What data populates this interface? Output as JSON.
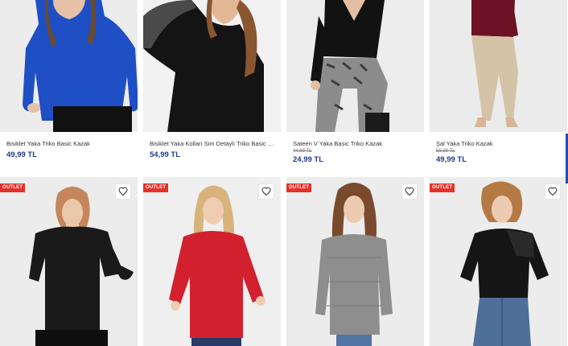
{
  "products_row1": [
    {
      "name": "Bisiklet Yaka Triko Basic Kazak",
      "old_price": "",
      "price": "49,99 TL"
    },
    {
      "name": "Bisiklet Yaka Kolları Sim Detaylı Triko Basic Ka...",
      "old_price": "",
      "price": "54,99 TL"
    },
    {
      "name": "Sateen V Yaka Basic Triko Kazak",
      "old_price": "44,99 TL",
      "price": "24,99 TL"
    },
    {
      "name": "Şal Yaka Triko Kazak",
      "old_price": "59,99 TL",
      "price": "49,99 TL"
    }
  ],
  "products_row2": [
    {
      "badge": "OUTLET"
    },
    {
      "badge": "OUTLET"
    },
    {
      "badge": "OUTLET"
    },
    {
      "badge": "OUTLET"
    }
  ],
  "icons": {
    "favorite": "heart-icon"
  },
  "colors": {
    "price": "#1d3b8f",
    "badge": "#e4322b",
    "accent": "#1d4fb3"
  }
}
